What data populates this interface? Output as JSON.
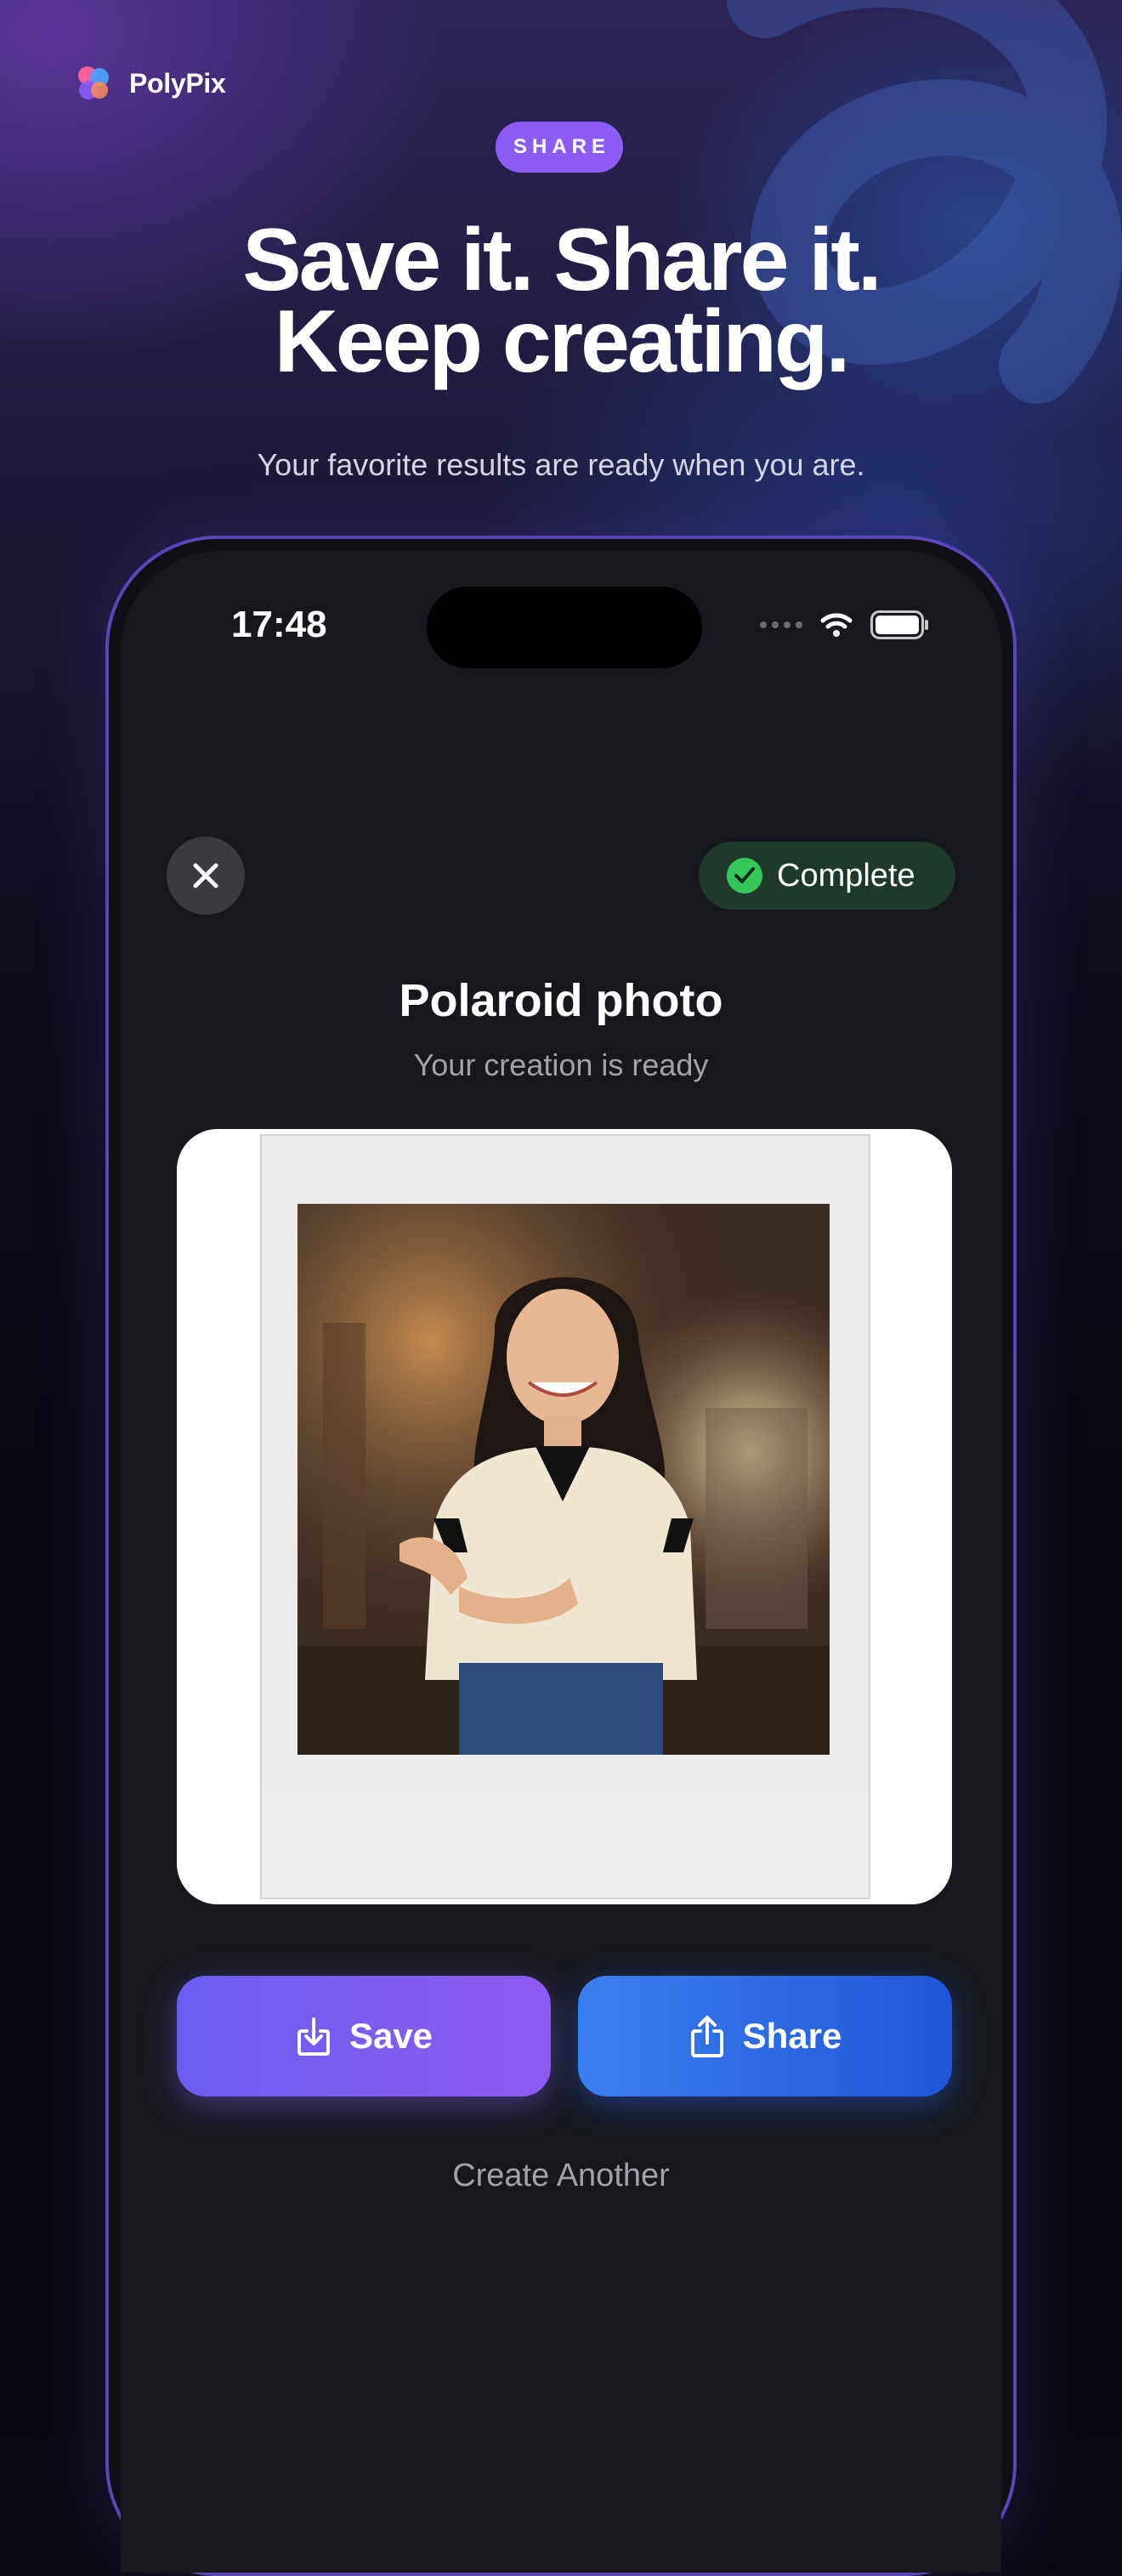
{
  "brand": {
    "name": "PolyPix"
  },
  "hero": {
    "pill": "SHARE",
    "headline_line1": "Save it. Share it.",
    "headline_line2": "Keep creating.",
    "subline": "Your favorite results are ready when you are."
  },
  "status_bar": {
    "time": "17:48",
    "icons": [
      "signal-dots-icon",
      "wifi-icon",
      "battery-icon"
    ]
  },
  "result": {
    "status": "Complete",
    "title": "Polaroid photo",
    "subtitle": "Your creation is ready",
    "image": "polaroid-portrait"
  },
  "actions": {
    "save": "Save",
    "share": "Share",
    "create_another": "Create Another"
  },
  "colors": {
    "accent_purple": "#8b5cf6",
    "save_button": "#7c5cf0",
    "share_button": "#2f6ce6",
    "complete_badge_bg": "#1f3a2c",
    "complete_check": "#34c759"
  }
}
